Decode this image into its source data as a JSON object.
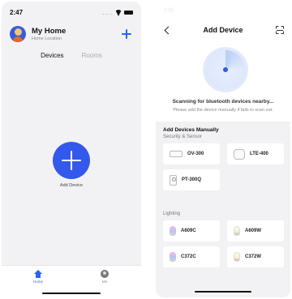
{
  "left_screen": {
    "status_bar": {
      "time": "2:47",
      "dots": "...."
    },
    "header": {
      "title": "My Home",
      "subtitle": "Home Location"
    },
    "tabs": [
      {
        "label": "Devices",
        "active": true
      },
      {
        "label": "Rooms",
        "active": false
      }
    ],
    "empty_state": {
      "add_label": "Add Device"
    },
    "bottom_nav": [
      {
        "label": "Home",
        "active": true,
        "icon": "home-icon"
      },
      {
        "label": "Me",
        "active": false,
        "icon": "profile-icon"
      }
    ]
  },
  "right_screen": {
    "status_bar": {
      "time": "2:26"
    },
    "header": {
      "title": "Add Device"
    },
    "scan": {
      "status": "Scanning for bluetooth devices nearby...",
      "hint": "Please add the device manually if fails to scan out."
    },
    "manual": {
      "title": "Add Devices Manually",
      "sections": [
        {
          "name": "Security & Sensor",
          "devices": [
            "OV-300",
            "LTE-400",
            "PT-300Q"
          ]
        },
        {
          "name": "Lighting",
          "devices": [
            "A609C",
            "A609W",
            "C372C",
            "C372W"
          ]
        }
      ]
    }
  },
  "colors": {
    "accent": "#2d63f0",
    "background": "#f2f2f4"
  }
}
